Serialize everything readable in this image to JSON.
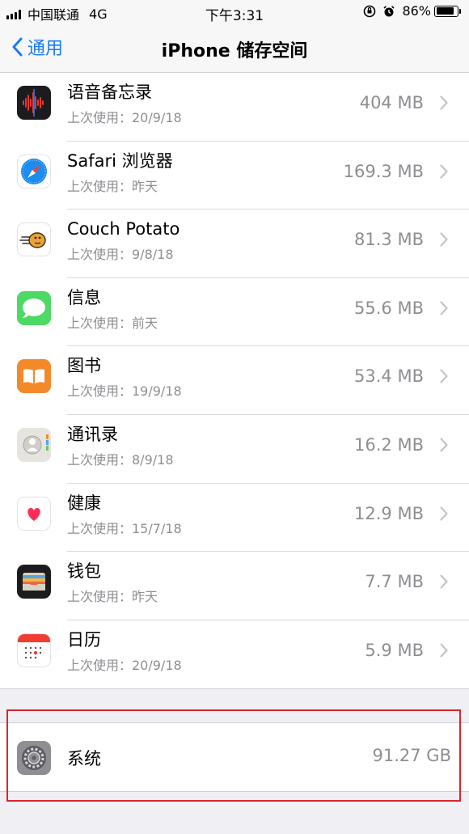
{
  "status_bar": {
    "carrier": "中国联通",
    "network": "4G",
    "time": "下午3:31",
    "battery_percent": "86%",
    "battery_level": 0.86
  },
  "nav": {
    "back_label": "通用",
    "title": "iPhone 储存空间"
  },
  "apps": [
    {
      "name": "语音备忘录",
      "last_used": "上次使用：20/9/18",
      "size": "404 MB",
      "icon": "voice-memos-icon"
    },
    {
      "name": "Safari 浏览器",
      "last_used": "上次使用：昨天",
      "size": "169.3 MB",
      "icon": "safari-icon"
    },
    {
      "name": "Couch Potato",
      "last_used": "上次使用：9/8/18",
      "size": "81.3 MB",
      "icon": "couch-potato-icon"
    },
    {
      "name": "信息",
      "last_used": "上次使用：前天",
      "size": "55.6 MB",
      "icon": "messages-icon"
    },
    {
      "name": "图书",
      "last_used": "上次使用：19/9/18",
      "size": "53.4 MB",
      "icon": "books-icon"
    },
    {
      "name": "通讯录",
      "last_used": "上次使用：8/9/18",
      "size": "16.2 MB",
      "icon": "contacts-icon"
    },
    {
      "name": "健康",
      "last_used": "上次使用：15/7/18",
      "size": "12.9 MB",
      "icon": "health-icon"
    },
    {
      "name": "钱包",
      "last_used": "上次使用：昨天",
      "size": "7.7 MB",
      "icon": "wallet-icon"
    },
    {
      "name": "日历",
      "last_used": "上次使用：20/9/18",
      "size": "5.9 MB",
      "icon": "calendar-icon"
    }
  ],
  "system": {
    "name": "系统",
    "size": "91.27 GB",
    "icon": "settings-gear-icon"
  },
  "colors": {
    "accent": "#1b7cf5",
    "highlight": "#d9262c",
    "secondary_text": "#8e8e93"
  }
}
